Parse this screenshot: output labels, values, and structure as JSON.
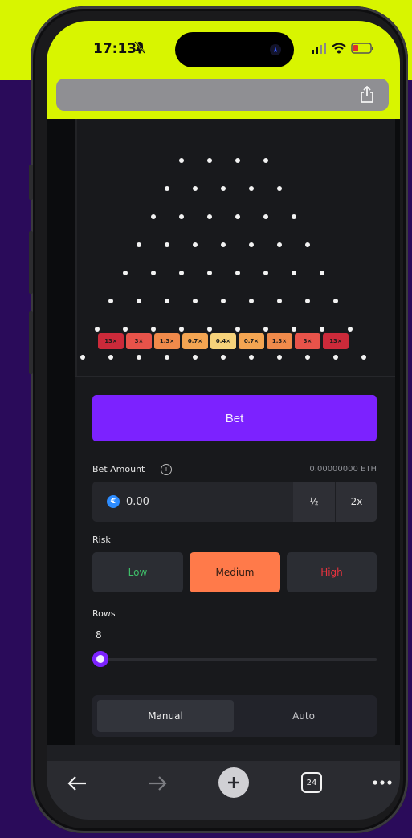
{
  "status_bar": {
    "time": "17:13"
  },
  "plinko": {
    "peg_rows": [
      4,
      5,
      6,
      7,
      8,
      9,
      10,
      11
    ],
    "multipliers": [
      {
        "label": "13×",
        "color": "#cc2a3a"
      },
      {
        "label": "3×",
        "color": "#e8534a"
      },
      {
        "label": "1.3×",
        "color": "#f08a4b"
      },
      {
        "label": "0.7×",
        "color": "#f4a552"
      },
      {
        "label": "0.4×",
        "color": "#f6d27a"
      },
      {
        "label": "0.7×",
        "color": "#f4a552"
      },
      {
        "label": "1.3×",
        "color": "#f08a4b"
      },
      {
        "label": "3×",
        "color": "#e8534a"
      },
      {
        "label": "13×",
        "color": "#cc2a3a"
      }
    ]
  },
  "bet": {
    "button_label": "Bet",
    "amount_label": "Bet Amount",
    "balance": "0.00000000 ETH",
    "amount_value": "0.00",
    "half_label": "½",
    "double_label": "2x"
  },
  "risk": {
    "label": "Risk",
    "options": [
      {
        "label": "Low",
        "color": "#3fbf6a",
        "selected": false
      },
      {
        "label": "Medium",
        "color": "#2b1a12",
        "selected": true
      },
      {
        "label": "High",
        "color": "#e8333e",
        "selected": false
      }
    ]
  },
  "rows": {
    "label": "Rows",
    "value": "8"
  },
  "mode": {
    "manual_label": "Manual",
    "auto_label": "Auto",
    "active": "Manual"
  },
  "toolbar": {
    "tabs_count": "24"
  },
  "colors": {
    "accent_purple": "#7c22ff",
    "medium_orange": "#ff7a4a",
    "yellow_bg": "#d8f500",
    "purple_bg": "#2a0b5a"
  }
}
